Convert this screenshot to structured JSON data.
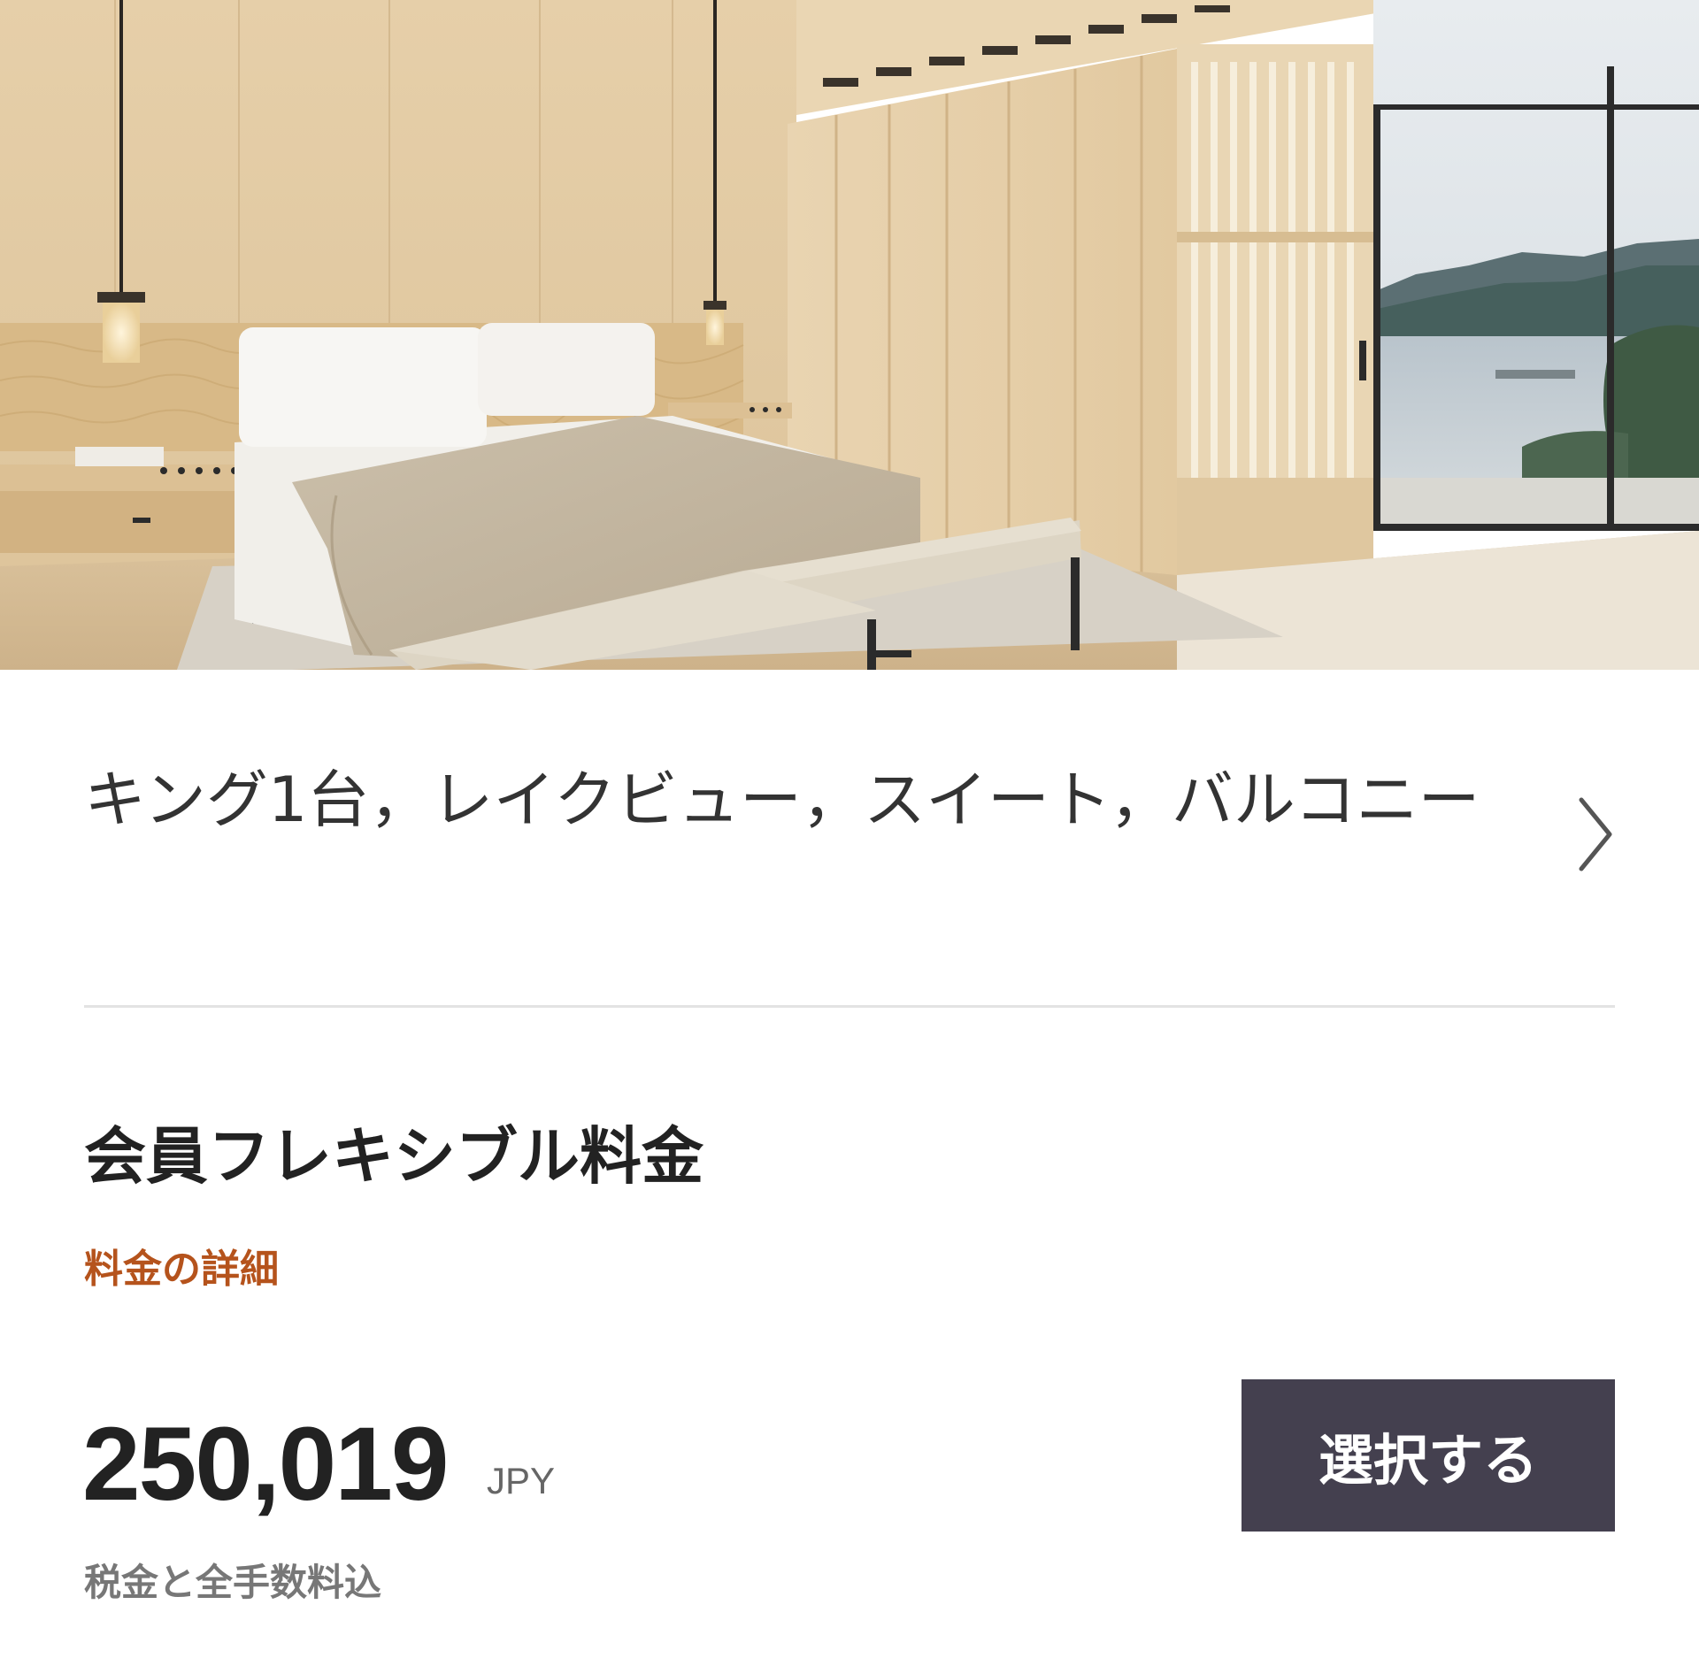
{
  "room": {
    "photo_alt": "room-photo",
    "title": "キング1台，レイクビュー，スイート，バルコニー",
    "chevron_icon": "chevron-right-icon"
  },
  "rate": {
    "name": "会員フレキシブル料金",
    "details_link": "料金の詳細"
  },
  "price": {
    "amount": "250,019",
    "currency": "JPY",
    "note": "税金と全手数料込"
  },
  "actions": {
    "select_label": "選択する"
  },
  "colors": {
    "accent_link": "#b5531c",
    "button_bg": "#44404f",
    "divider": "#e3e3e3"
  }
}
